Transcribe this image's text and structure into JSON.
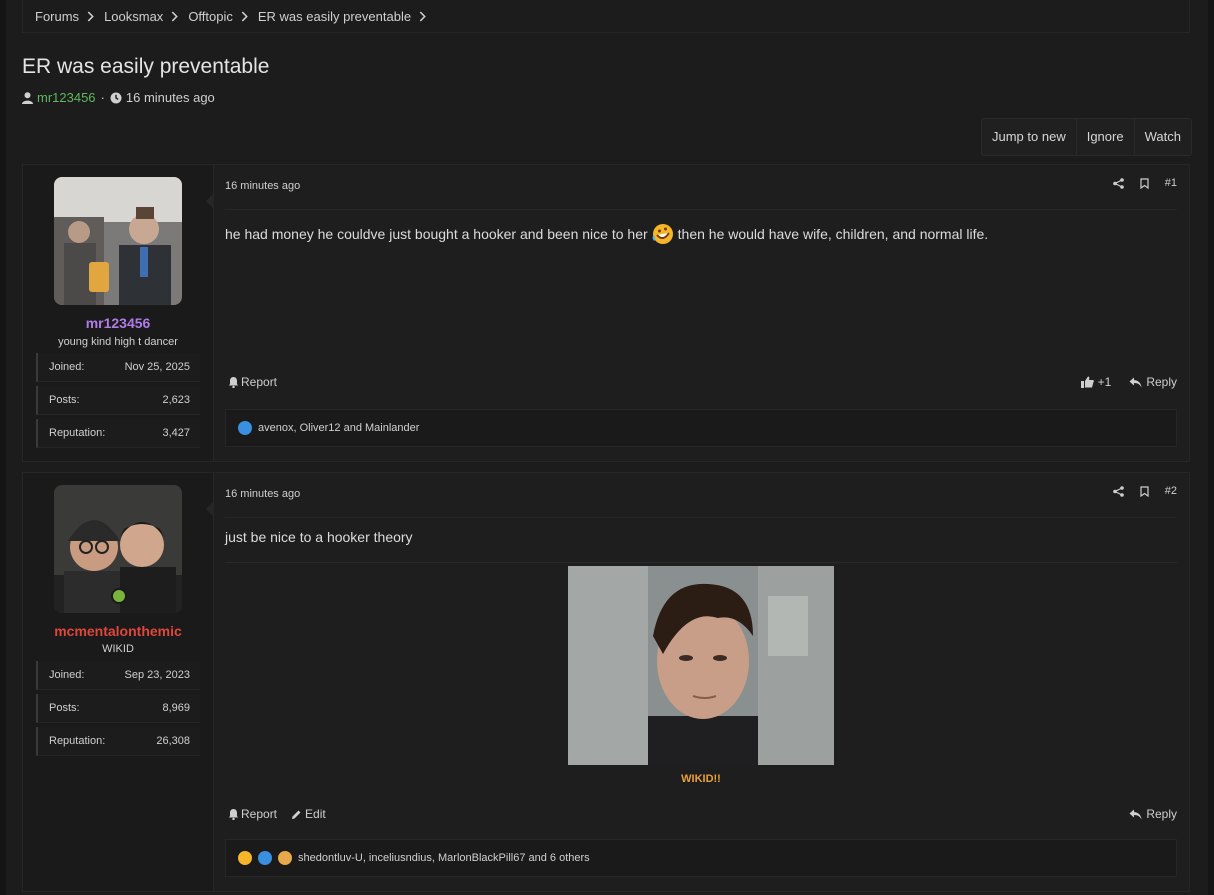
{
  "breadcrumb": [
    "Forums",
    "Looksmax",
    "Offtopic",
    "ER was easily preventable"
  ],
  "thread": {
    "title": "ER was easily preventable",
    "author": "mr123456",
    "sep": "·",
    "time": "16 minutes ago"
  },
  "actions": [
    "Jump to new",
    "Ignore",
    "Watch"
  ],
  "posts": [
    {
      "time": "16 minutes ago",
      "number": "#1",
      "user": {
        "name": "mr123456",
        "name_color": "#b07be8",
        "title": "young kind high t dancer",
        "online": false,
        "stats": [
          {
            "label": "Joined:",
            "value": "Nov 25, 2025"
          },
          {
            "label": "Posts:",
            "value": "2,623"
          },
          {
            "label": "Reputation:",
            "value": "3,427"
          }
        ]
      },
      "body_before": "he had money he couldve just bought a hooker and been nice to her",
      "body_after": "then he would have wife, children, and normal life.",
      "report_label": "Report",
      "like_label": "+1",
      "reply_label": "Reply",
      "reactions_text": "avenox, Oliver12 and Mainlander"
    },
    {
      "time": "16 minutes ago",
      "number": "#2",
      "user": {
        "name": "mcmentalonthemic",
        "name_color": "#e0463c",
        "title": "WIKID",
        "online": true,
        "stats": [
          {
            "label": "Joined:",
            "value": "Sep 23, 2023"
          },
          {
            "label": "Posts:",
            "value": "8,969"
          },
          {
            "label": "Reputation:",
            "value": "26,308"
          }
        ]
      },
      "body": "just be nice to a hooker theory",
      "caption": "WIKID!!",
      "report_label": "Report",
      "edit_label": "Edit",
      "reply_label": "Reply",
      "reactions_text": "shedontluv-U, inceliusndius, MarlonBlackPill67 and 6 others"
    }
  ],
  "colors": {
    "accent_green": "#5fb75f",
    "caption": "#e8a03a"
  }
}
